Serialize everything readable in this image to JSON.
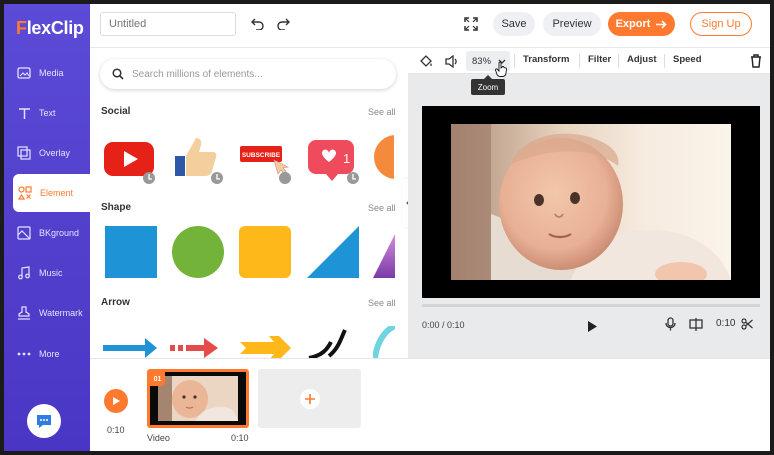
{
  "app": {
    "brand_first": "F",
    "brand_rest": "lexClip"
  },
  "sidebar": {
    "items": [
      {
        "label": "Media",
        "icon": "media-icon"
      },
      {
        "label": "Text",
        "icon": "text-icon"
      },
      {
        "label": "Overlay",
        "icon": "overlay-icon"
      },
      {
        "label": "Element",
        "icon": "element-icon",
        "active": true
      },
      {
        "label": "BKground",
        "icon": "background-icon"
      },
      {
        "label": "Music",
        "icon": "music-icon"
      },
      {
        "label": "Watermark",
        "icon": "watermark-icon"
      },
      {
        "label": "More",
        "icon": "more-icon"
      }
    ],
    "help_icon": "chat-help-icon"
  },
  "topbar": {
    "title_placeholder": "Untitled",
    "save_label": "Save",
    "preview_label": "Preview",
    "export_label": "Export",
    "signup_label": "Sign Up"
  },
  "panel": {
    "search_placeholder": "Search millions of elements...",
    "sections": [
      {
        "title": "Social",
        "see_all": "See all"
      },
      {
        "title": "Shape",
        "see_all": "See all"
      },
      {
        "title": "Arrow",
        "see_all": "See all"
      }
    ],
    "social_items": [
      "youtube-logo",
      "thumbs-up",
      "subscribe-button",
      "like-notification",
      "partial-item"
    ],
    "subscribe_text": "SUBSCRIBE",
    "like_count": "1"
  },
  "editor": {
    "toolbar": {
      "zoom_value": "83%",
      "zoom_tooltip": "Zoom",
      "transform": "Transform",
      "filter": "Filter",
      "adjust": "Adjust",
      "speed": "Speed"
    },
    "time_position": "0:00 / 0:10",
    "clip_duration": "0:10"
  },
  "timeline": {
    "total_time": "0:10",
    "clip_number": "01",
    "clip_label": "Video",
    "clip_duration": "0:10"
  },
  "colors": {
    "accent": "#ff7a2e",
    "sidebar": "#5b4bd6"
  }
}
